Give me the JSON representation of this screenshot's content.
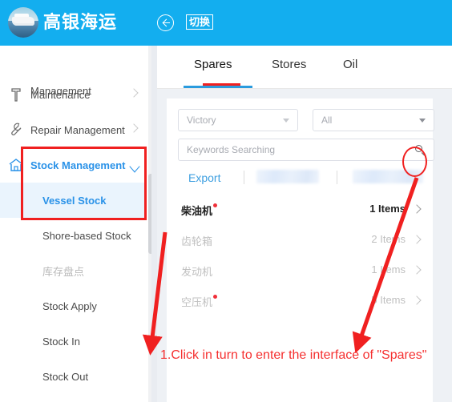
{
  "header": {
    "brand": "高银海运",
    "logo_icon": "ship-photo-logo",
    "back_icon": "back-arrow-icon",
    "switch_label": "切换"
  },
  "sidebar": {
    "cut_off_top_label": "Management",
    "items": [
      {
        "label": "Maintenance",
        "icon": "hammer-icon",
        "has_chevron": true
      },
      {
        "label": "Repair Management",
        "icon": "wrench-icon",
        "has_chevron": true
      },
      {
        "label": "Stock Management",
        "icon": "home-icon",
        "expanded": true
      }
    ],
    "sub_items": [
      {
        "label": "Vessel Stock",
        "active": true
      },
      {
        "label": "Shore-based Stock",
        "active": false
      },
      {
        "label": "库存盘点",
        "active": false,
        "dim": true
      },
      {
        "label": "Stock Apply",
        "active": false
      },
      {
        "label": "Stock In",
        "active": false
      },
      {
        "label": "Stock Out",
        "active": false
      }
    ]
  },
  "main": {
    "tabs": [
      {
        "label": "Spares",
        "active": true
      },
      {
        "label": "Stores",
        "active": false
      },
      {
        "label": "Oil",
        "active": false
      }
    ],
    "filters": {
      "vessel_value": "Victory",
      "category_value": "All"
    },
    "search": {
      "placeholder": "Keywords Searching",
      "value": "",
      "icon": "search-icon"
    },
    "toolbar": {
      "export_label": "Export",
      "redacted_count": 2
    },
    "list": [
      {
        "name": "柴油机",
        "badge": true,
        "count": "1 Items",
        "active": true
      },
      {
        "name": "齿轮箱",
        "badge": false,
        "count": "2 Items",
        "active": false
      },
      {
        "name": "发动机",
        "badge": false,
        "count": "1 Items",
        "active": false
      },
      {
        "name": "空压机",
        "badge": true,
        "count": "5 Items",
        "active": false
      }
    ]
  },
  "annotations": {
    "step_text": "1.Click in turn to enter the interface of \"Spares\"",
    "accent_color": "#f02020"
  }
}
